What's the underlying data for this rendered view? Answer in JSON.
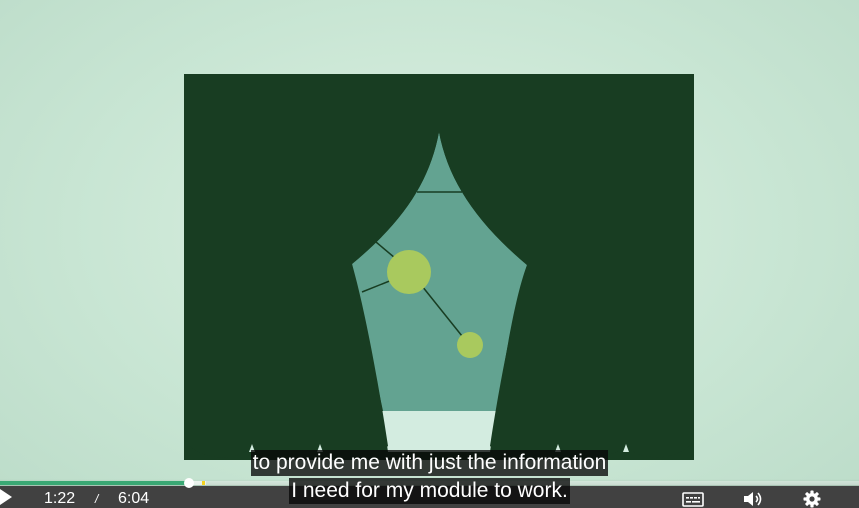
{
  "player": {
    "current_time": "1:22",
    "time_separator": "/",
    "duration": "6:04",
    "progress_fraction": 0.22,
    "buffered_fraction": 0.24,
    "accent_color": "#3aa874",
    "marker_color": "#f5d320"
  },
  "captions": {
    "line1": "to provide me with just the information",
    "line2": "I need for my module to work."
  },
  "colors": {
    "curtain": "#183d22",
    "window": "#63a391",
    "node": "#a9c95e",
    "background": "#c9e6d4"
  },
  "icons": {
    "play": "play-icon",
    "captions": "closed-captions-icon",
    "volume": "volume-icon",
    "settings": "gear-icon"
  }
}
